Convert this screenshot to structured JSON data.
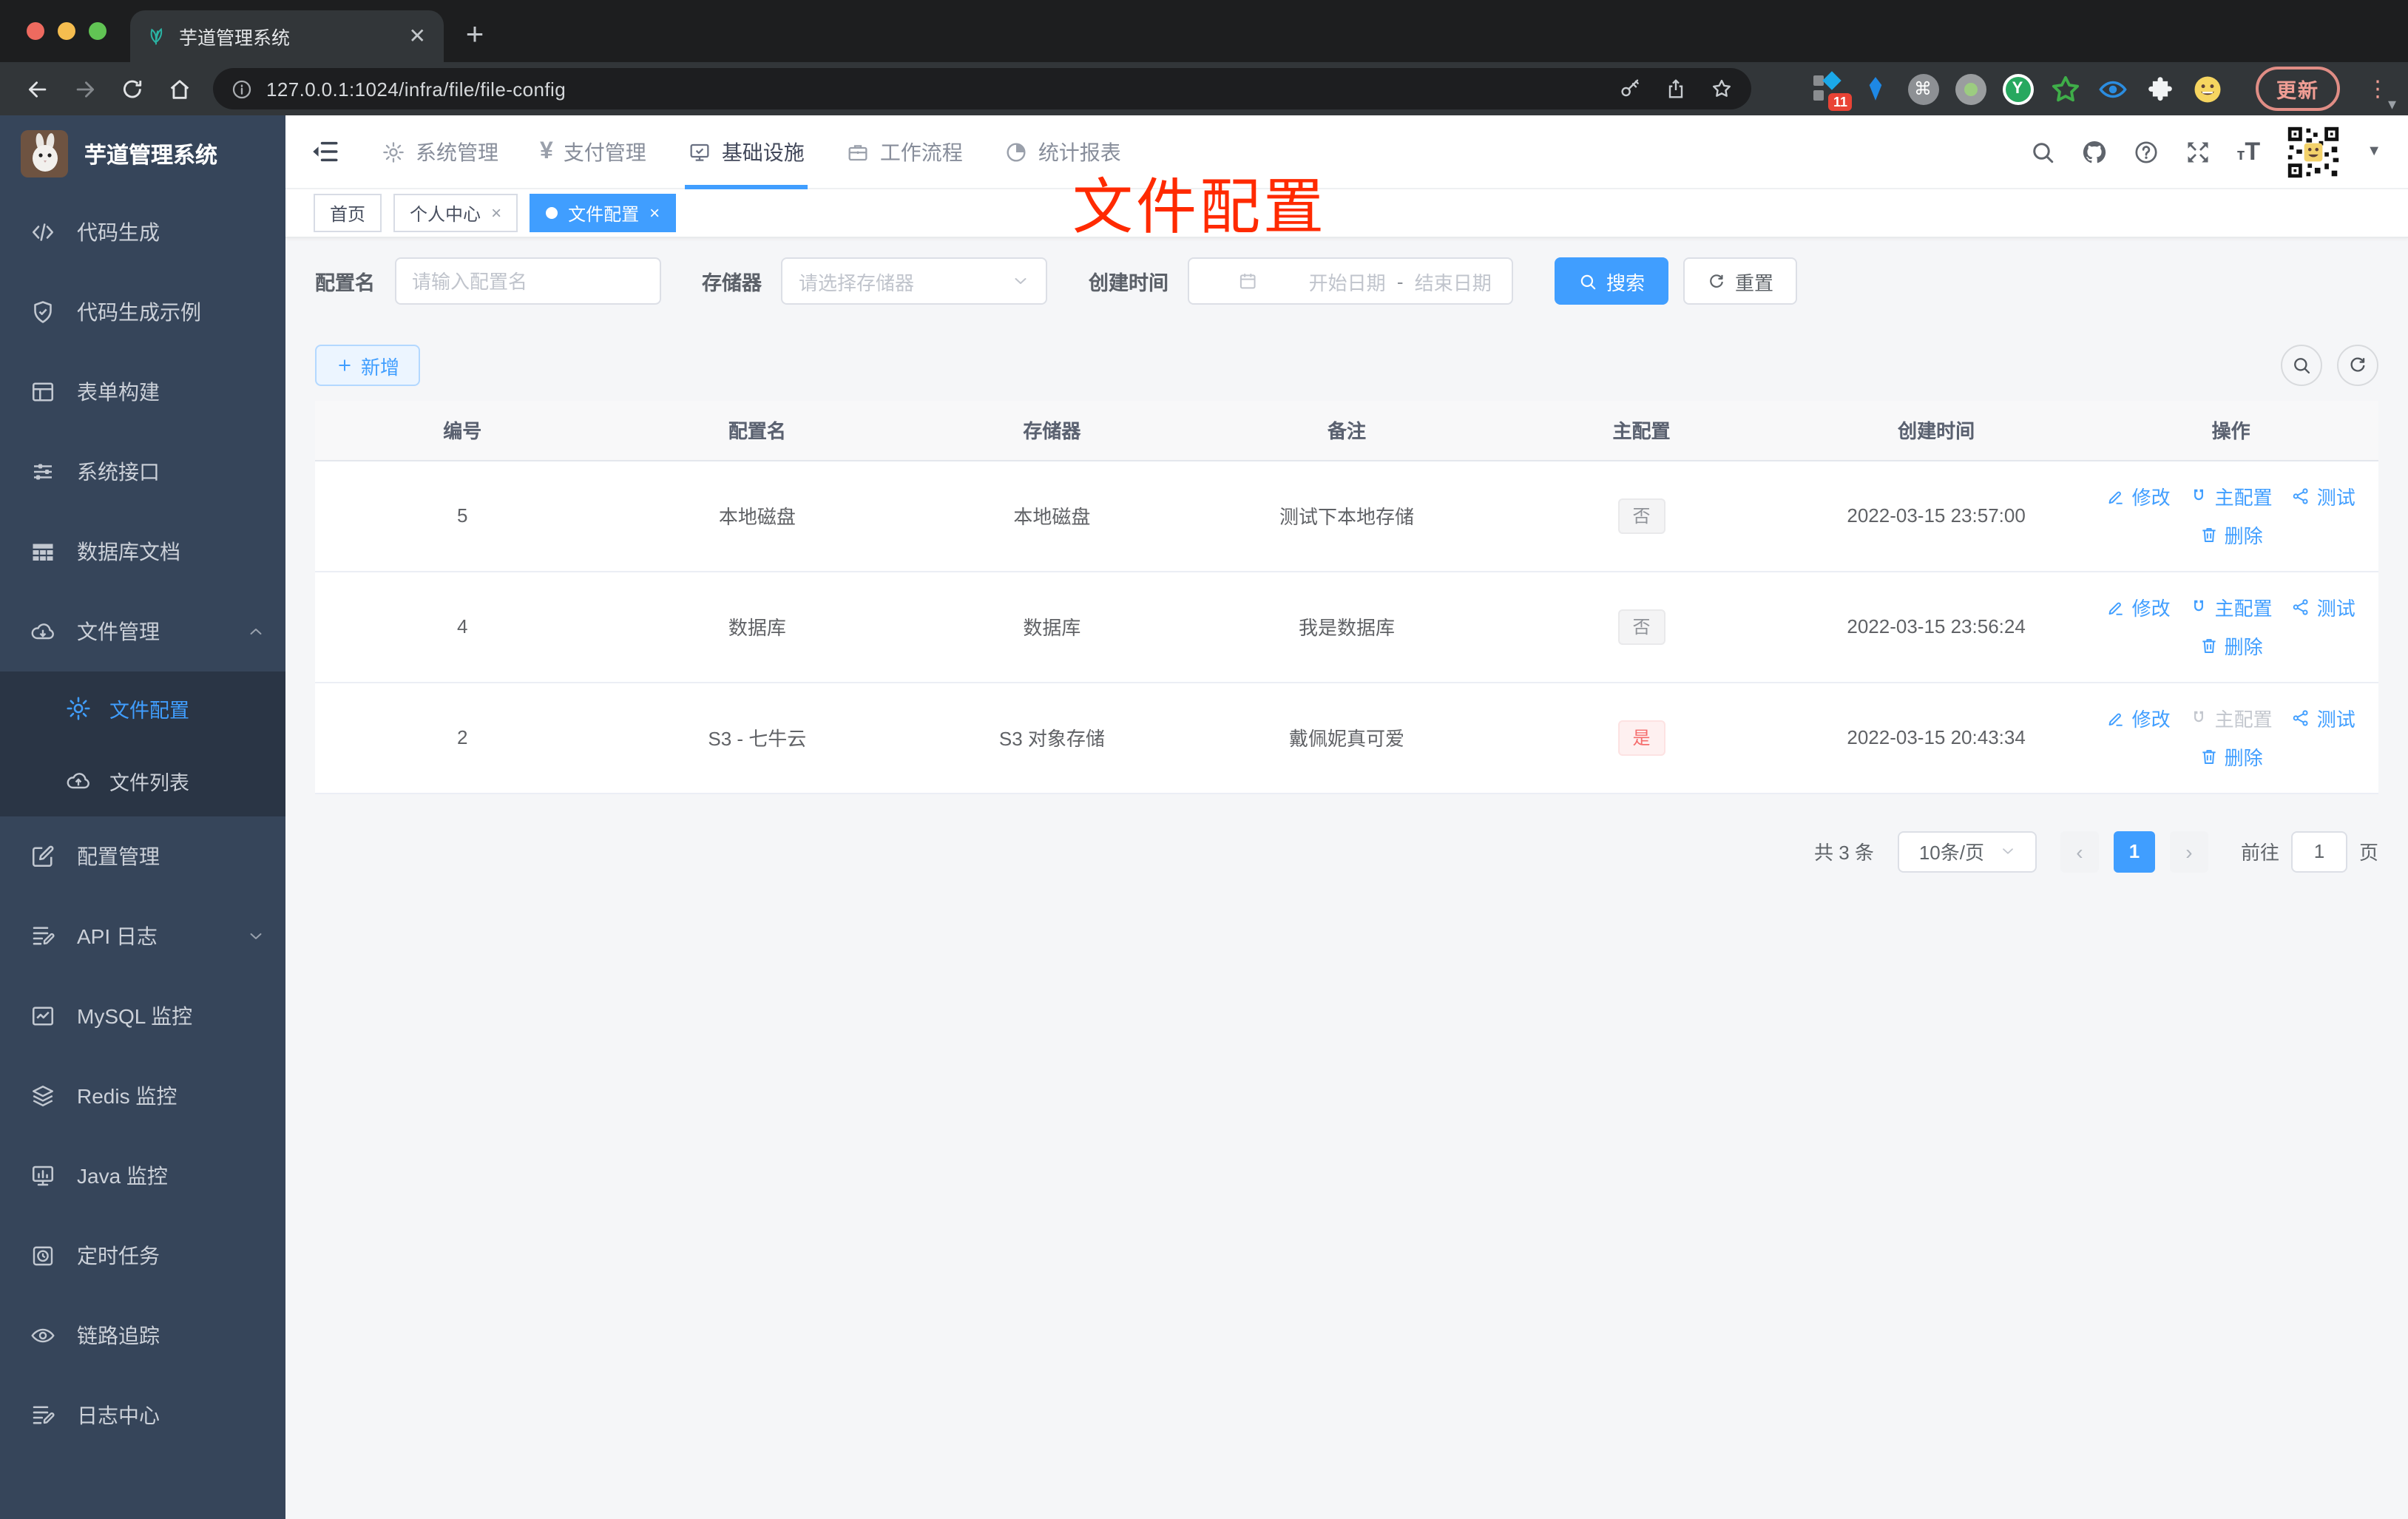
{
  "browser": {
    "tab_title": "芋道管理系统",
    "new_tab": "+",
    "url": "127.0.0.1:1024/infra/file/file-config",
    "extension_badge": "11",
    "update_button": "更新"
  },
  "sidebar": {
    "title": "芋道管理系统",
    "items": [
      "代码生成",
      "代码生成示例",
      "表单构建",
      "系统接口",
      "数据库文档",
      "文件管理",
      "文件配置",
      "文件列表",
      "配置管理",
      "API 日志",
      "MySQL 监控",
      "Redis 监控",
      "Java 监控",
      "定时任务",
      "链路追踪",
      "日志中心"
    ]
  },
  "topnav": {
    "items": [
      "系统管理",
      "支付管理",
      "基础设施",
      "工作流程",
      "统计报表"
    ],
    "yen": "¥"
  },
  "tags": {
    "items": [
      "首页",
      "个人中心",
      "文件配置"
    ]
  },
  "annotation": "文件配置",
  "filter": {
    "name_label": "配置名",
    "name_placeholder": "请输入配置名",
    "storage_label": "存储器",
    "storage_placeholder": "请选择存储器",
    "time_label": "创建时间",
    "start_placeholder": "开始日期",
    "separator": "-",
    "end_placeholder": "结束日期",
    "search": "搜索",
    "reset": "重置"
  },
  "toolbar": {
    "add": "新增"
  },
  "table": {
    "headers": [
      "编号",
      "配置名",
      "存储器",
      "备注",
      "主配置",
      "创建时间",
      "操作"
    ],
    "actions": {
      "edit": "修改",
      "master": "主配置",
      "test": "测试",
      "delete": "删除"
    },
    "rows": [
      {
        "id": "5",
        "name": "本地磁盘",
        "storage": "本地磁盘",
        "remark": "测试下本地存储",
        "master": "否",
        "time": "2022-03-15 23:57:00"
      },
      {
        "id": "4",
        "name": "数据库",
        "storage": "数据库",
        "remark": "我是数据库",
        "master": "否",
        "time": "2022-03-15 23:56:24"
      },
      {
        "id": "2",
        "name": "S3 - 七牛云",
        "storage": "S3 对象存储",
        "remark": "戴佩妮真可爱",
        "master": "是",
        "time": "2022-03-15 20:43:34"
      }
    ]
  },
  "pagination": {
    "total": "共 3 条",
    "page_size": "10条/页",
    "current": "1",
    "goto": "前往",
    "goto_value": "1",
    "page_unit": "页"
  },
  "colors": {
    "primary": "#409eff",
    "danger": "#f56c6c",
    "annotation_red": "#ff2a00",
    "sidebar_bg": "#36455a"
  }
}
